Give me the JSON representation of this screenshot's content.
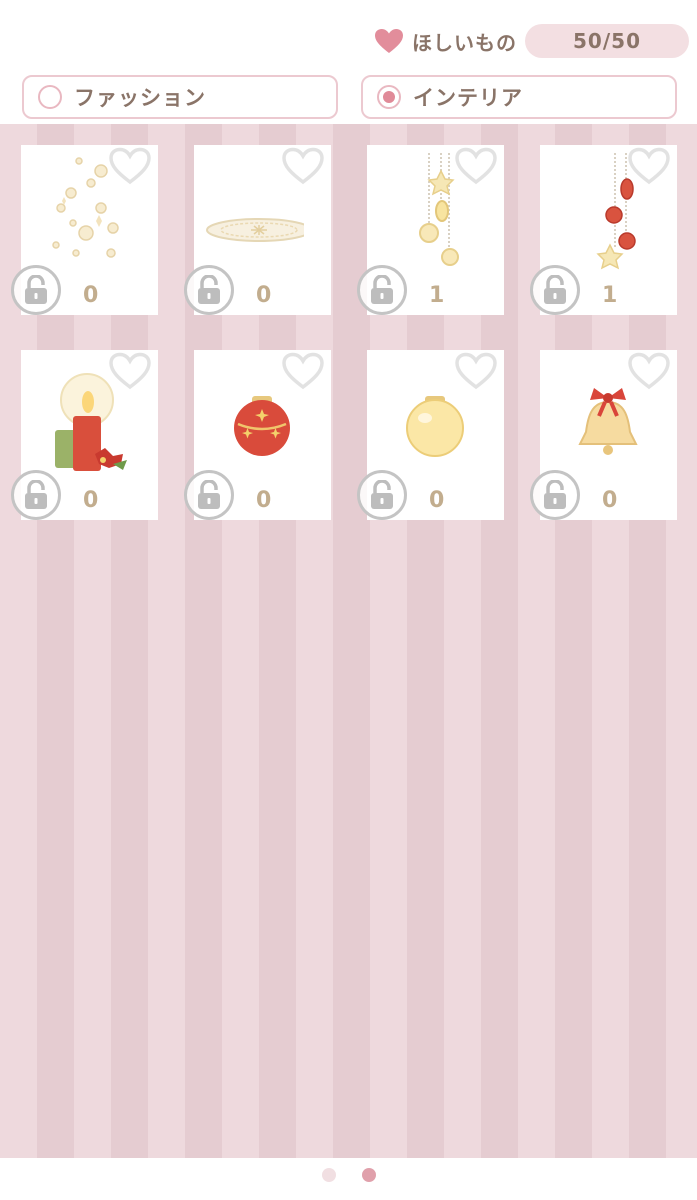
{
  "header": {
    "wishlist_label": "ほしいもの",
    "wishlist_count": "50/50"
  },
  "tabs": [
    {
      "label": "ファッション",
      "selected": false
    },
    {
      "label": "インテリア",
      "selected": true
    }
  ],
  "items": [
    {
      "icon": "sparkle-bubbles-icon",
      "count": "0"
    },
    {
      "icon": "snowflake-rug-icon",
      "count": "0"
    },
    {
      "icon": "gold-hanging-ornaments-icon",
      "count": "1"
    },
    {
      "icon": "red-hanging-ornaments-icon",
      "count": "1"
    },
    {
      "icon": "christmas-candles-icon",
      "count": "0"
    },
    {
      "icon": "red-ornament-ball-icon",
      "count": "0"
    },
    {
      "icon": "gold-ornament-ball-icon",
      "count": "0"
    },
    {
      "icon": "bell-with-ribbon-icon",
      "count": "0"
    }
  ],
  "pager": {
    "pages": 2,
    "current": 2
  },
  "colors": {
    "accent_pink": "#e08a98",
    "stripe_light": "#eed9dd",
    "stripe_dark": "#e5ccd1",
    "count_text": "#c2ad8e"
  }
}
